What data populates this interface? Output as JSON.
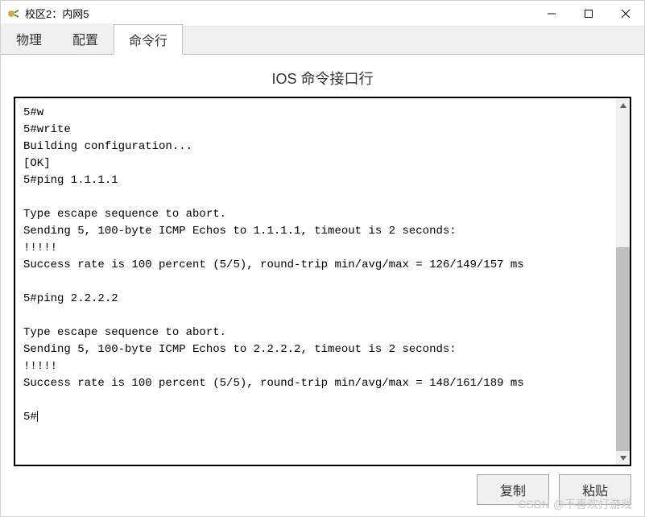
{
  "window": {
    "title": "校区2：内网5"
  },
  "tabs": {
    "items": [
      {
        "label": "物理"
      },
      {
        "label": "配置"
      },
      {
        "label": "命令行"
      }
    ]
  },
  "content": {
    "title": "IOS 命令接口行"
  },
  "terminal": {
    "lines": "5#w\n5#write\nBuilding configuration...\n[OK]\n5#ping 1.1.1.1\n\nType escape sequence to abort.\nSending 5, 100-byte ICMP Echos to 1.1.1.1, timeout is 2 seconds:\n!!!!!\nSuccess rate is 100 percent (5/5), round-trip min/avg/max = 126/149/157 ms\n\n5#ping 2.2.2.2\n\nType escape sequence to abort.\nSending 5, 100-byte ICMP Echos to 2.2.2.2, timeout is 2 seconds:\n!!!!!\nSuccess rate is 100 percent (5/5), round-trip min/avg/max = 148/161/189 ms\n\n5#"
  },
  "buttons": {
    "copy": "复制",
    "paste": "粘贴"
  },
  "watermark": "CSDN @不喜欢打游戏"
}
